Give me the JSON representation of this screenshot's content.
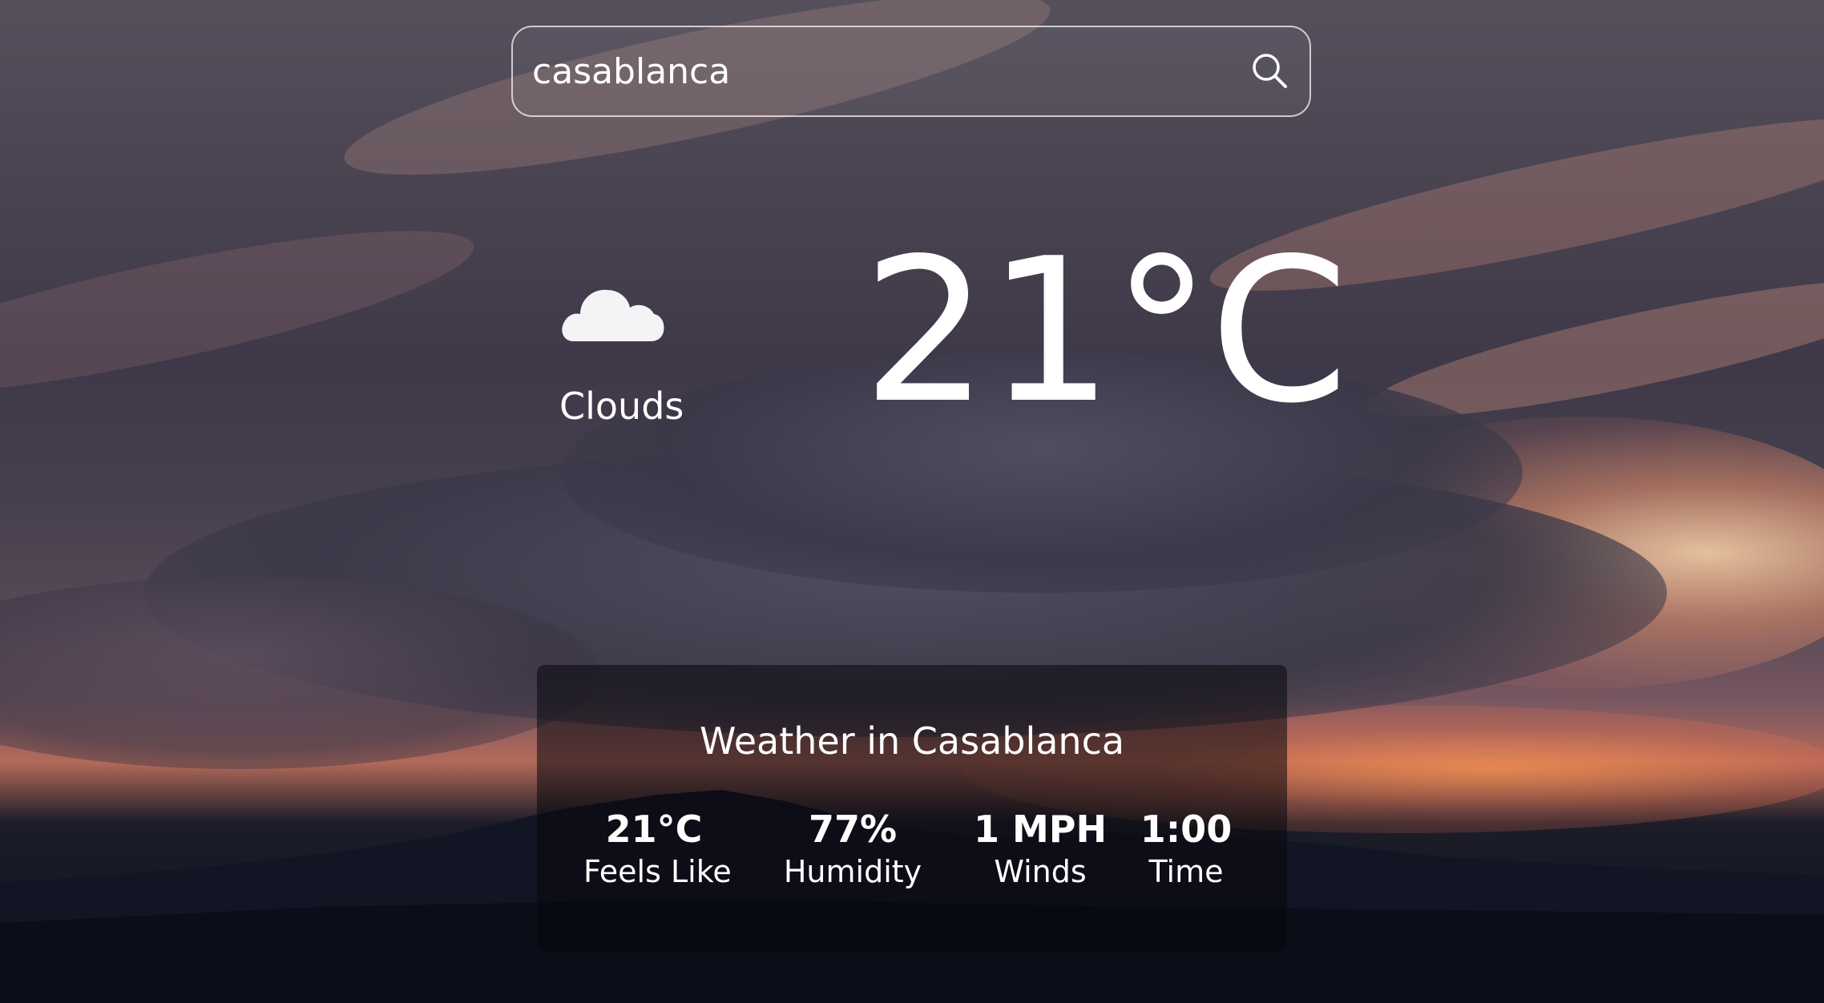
{
  "search": {
    "value": "casablanca"
  },
  "current": {
    "icon": "cloud-icon",
    "condition": "Clouds",
    "temperature": "21°C"
  },
  "details": {
    "title": "Weather in Casablanca",
    "stats": [
      {
        "value": "21°C",
        "label": "Feels Like"
      },
      {
        "value": "77%",
        "label": "Humidity"
      },
      {
        "value": "1 MPH",
        "label": "Winds"
      },
      {
        "value": "1:00",
        "label": "Time"
      }
    ]
  },
  "icons": {
    "search": "search-icon"
  }
}
